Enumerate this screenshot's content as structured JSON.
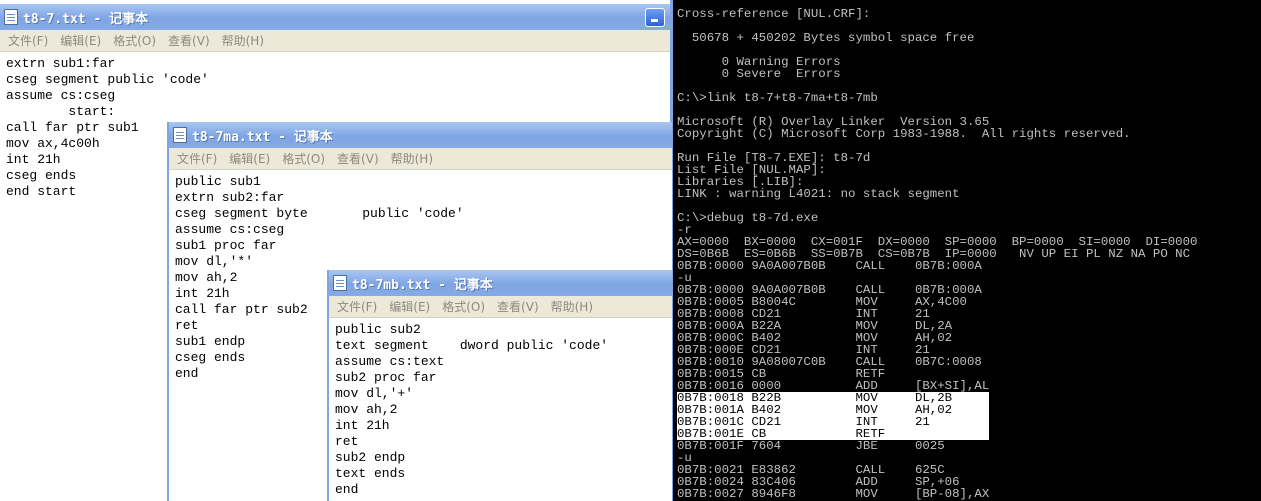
{
  "window1": {
    "title": "t8-7.txt - 记事本",
    "menu": [
      "文件(F)",
      "编辑(E)",
      "格式(O)",
      "查看(V)",
      "帮助(H)"
    ],
    "lines": [
      "extrn sub1:far",
      "cseg segment public 'code'",
      "assume cs:cseg",
      "        start:",
      "call far ptr sub1",
      "mov ax,4c00h",
      "int 21h",
      "cseg ends",
      "end start"
    ]
  },
  "window2": {
    "title": "t8-7ma.txt - 记事本",
    "menu": [
      "文件(F)",
      "编辑(E)",
      "格式(O)",
      "查看(V)",
      "帮助(H)"
    ],
    "lines": [
      "public sub1",
      "extrn sub2:far",
      "cseg segment byte       public 'code'",
      "assume cs:cseg",
      "sub1 proc far",
      "mov dl,'*'",
      "mov ah,2",
      "int 21h",
      "call far ptr sub2",
      "ret",
      "sub1 endp",
      "cseg ends",
      "end"
    ]
  },
  "window3": {
    "title": "t8-7mb.txt - 记事本",
    "menu": [
      "文件(F)",
      "编辑(E)",
      "格式(O)",
      "查看(V)",
      "帮助(H)"
    ],
    "lines": [
      "public sub2",
      "text segment    dword public 'code'",
      "assume cs:text",
      "sub2 proc far",
      "mov dl,'+'",
      "mov ah,2",
      "int 21h",
      "ret",
      "sub2 endp",
      "text ends",
      "end"
    ]
  },
  "console": {
    "lines": [
      "Cross-reference [NUL.CRF]:",
      "",
      "  50678 + 450202 Bytes symbol space free",
      "",
      "      0 Warning Errors",
      "      0 Severe  Errors",
      "",
      "C:\\>link t8-7+t8-7ma+t8-7mb",
      "",
      "Microsoft (R) Overlay Linker  Version 3.65",
      "Copyright (C) Microsoft Corp 1983-1988.  All rights reserved.",
      "",
      "Run File [T8-7.EXE]: t8-7d",
      "List File [NUL.MAP]:",
      "Libraries [.LIB]:",
      "LINK : warning L4021: no stack segment",
      "",
      "C:\\>debug t8-7d.exe",
      "-r",
      "AX=0000  BX=0000  CX=001F  DX=0000  SP=0000  BP=0000  SI=0000  DI=0000",
      "DS=0B6B  ES=0B6B  SS=0B7B  CS=0B7B  IP=0000   NV UP EI PL NZ NA PO NC",
      "0B7B:0000 9A0A007B0B    CALL    0B7B:000A",
      "-u",
      "0B7B:0000 9A0A007B0B    CALL    0B7B:000A",
      "0B7B:0005 B8004C        MOV     AX,4C00",
      "0B7B:0008 CD21          INT     21",
      "0B7B:000A B22A          MOV     DL,2A",
      "0B7B:000C B402          MOV     AH,02",
      "0B7B:000E CD21          INT     21",
      "0B7B:0010 9A08007C0B    CALL    0B7C:0008",
      "0B7B:0015 CB            RETF",
      "0B7B:0016 0000          ADD     [BX+SI],AL",
      "0B7B:0018 B22B          MOV     DL,2B",
      "0B7B:001A B402          MOV     AH,02",
      "0B7B:001C CD21          INT     21",
      "0B7B:001E CB            RETF",
      "0B7B:001F 7604          JBE     0025",
      "-u",
      "0B7B:0021 E83862        CALL    625C",
      "0B7B:0024 83C406        ADD     SP,+06",
      "0B7B:0027 8946F8        MOV     [BP-08],AX"
    ],
    "highlighted_lines": [
      32,
      33,
      34,
      35
    ]
  },
  "colors": {
    "titlebar": "#7fa5e3",
    "menubar": "#ece9d8",
    "console_bg": "#000000",
    "console_text": "#c0c0c0",
    "highlight": "#ffffff"
  }
}
